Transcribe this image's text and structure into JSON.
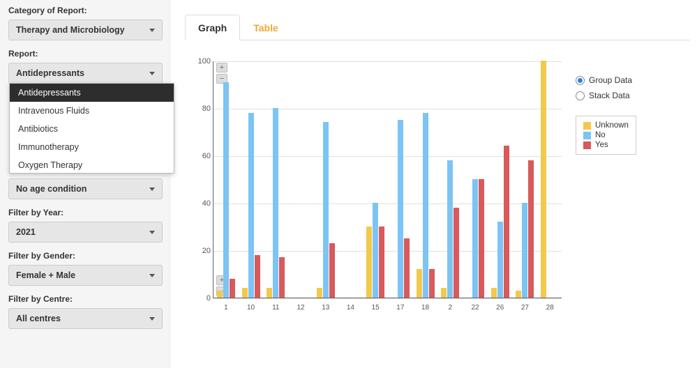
{
  "sidebar": {
    "category_label": "Category of Report:",
    "category_value": "Therapy and Microbiology",
    "report_label": "Report:",
    "report_value": "Antidepressants",
    "report_options": [
      "Antidepressants",
      "Intravenous Fluids",
      "Antibiotics",
      "Immunotherapy",
      "Oxygen Therapy"
    ],
    "age_value": "No age condition",
    "year_label": "Filter by Year:",
    "year_value": "2021",
    "gender_label": "Filter by Gender:",
    "gender_value": "Female + Male",
    "centre_label": "Filter by Centre:",
    "centre_value": "All centres"
  },
  "tabs": {
    "graph": "Graph",
    "table": "Table"
  },
  "controls": {
    "group": "Group Data",
    "stack": "Stack Data"
  },
  "legend": {
    "unknown": "Unknown",
    "no": "No",
    "yes": "Yes"
  },
  "chart_data": {
    "type": "bar",
    "categories": [
      "1",
      "10",
      "11",
      "12",
      "13",
      "14",
      "15",
      "17",
      "18",
      "2",
      "22",
      "26",
      "27",
      "28"
    ],
    "series": [
      {
        "name": "Unknown",
        "values": [
          3,
          4,
          4,
          0,
          4,
          0,
          30,
          0,
          12,
          4,
          0,
          4,
          3,
          100
        ]
      },
      {
        "name": "No",
        "values": [
          91,
          78,
          80,
          0,
          74,
          0,
          40,
          75,
          78,
          58,
          50,
          32,
          40,
          0
        ]
      },
      {
        "name": "Yes",
        "values": [
          8,
          18,
          17,
          0,
          23,
          0,
          30,
          25,
          12,
          38,
          50,
          64,
          58,
          0
        ]
      }
    ],
    "ylim": [
      0,
      100
    ],
    "yticks": [
      0,
      20,
      40,
      60,
      80,
      100
    ],
    "ylabel": "",
    "xlabel": "",
    "title": ""
  }
}
